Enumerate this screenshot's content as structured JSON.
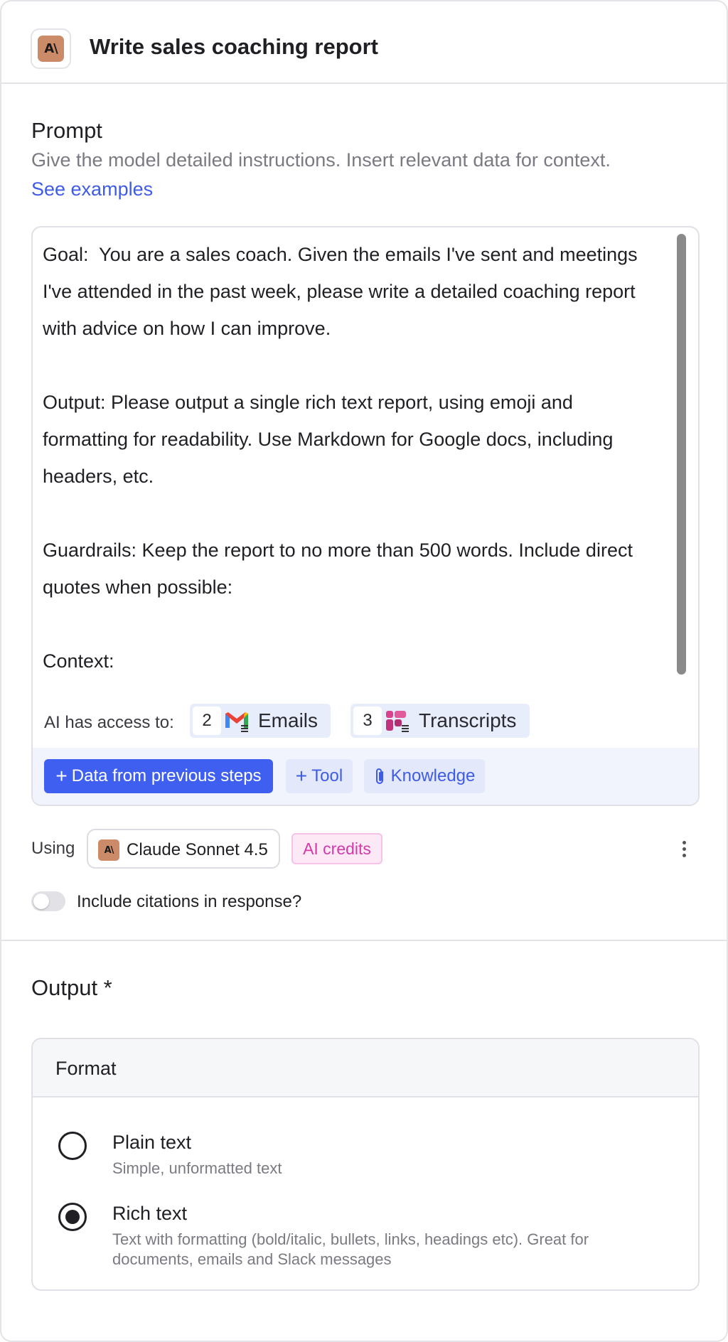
{
  "header": {
    "logo_text": "A\\",
    "title": "Write sales coaching report"
  },
  "prompt": {
    "title": "Prompt",
    "helper": "Give the model detailed instructions. Insert relevant data for context.",
    "examples_link": "See examples",
    "text": "Goal:  You are a sales coach. Given the emails I've sent and meetings\nI've attended in the past week, please write a detailed coaching report\nwith advice on how I can improve.\n\nOutput: Please output a single rich text report, using emoji and\nformatting for readability. Use Markdown for Google docs, including\nheaders, etc.\n\nGuardrails: Keep the report to no more than 500 words. Include direct\nquotes when possible:\n\nContext:",
    "access_label": "AI has access to:",
    "access": [
      {
        "count": "2",
        "icon": "gmail-icon",
        "label": "Emails"
      },
      {
        "count": "3",
        "icon": "transcripts-icon",
        "label": "Transcripts"
      }
    ],
    "actions": {
      "data_button": "Data from previous steps",
      "tool_button": "Tool",
      "knowledge_button": "Knowledge"
    }
  },
  "model": {
    "using_label": "Using",
    "logo_text": "A\\",
    "name": "Claude Sonnet 4.5",
    "credits_badge": "AI credits"
  },
  "citations": {
    "label": "Include citations in response?",
    "enabled": false
  },
  "output": {
    "title": "Output *",
    "format_title": "Format",
    "options": [
      {
        "title": "Plain text",
        "desc": "Simple, unformatted text",
        "selected": false
      },
      {
        "title": "Rich text",
        "desc": "Text with formatting (bold/italic, bullets, links, headings etc). Great for documents, emails and Slack messages",
        "selected": true
      }
    ]
  },
  "colors": {
    "accent": "#3f5ff0",
    "link": "#3e5ce6",
    "brand_logo": "#cc8b68",
    "credits": "#d23aa8"
  }
}
